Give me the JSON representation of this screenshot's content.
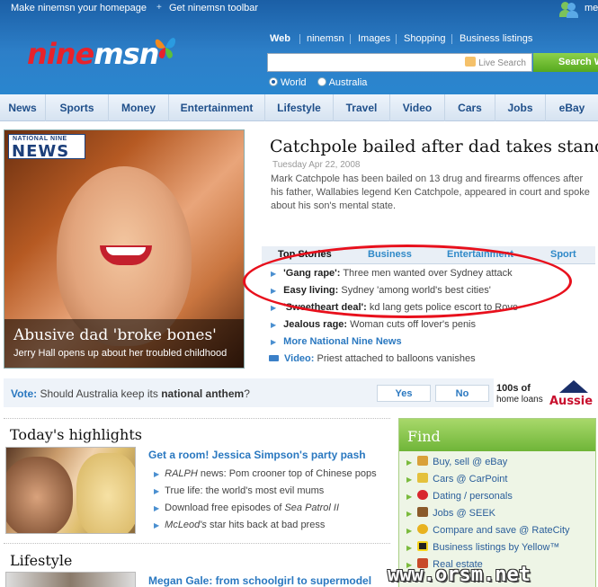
{
  "toplinks": {
    "homepage": "Make ninemsn your homepage",
    "toolbar_icon": "plus-icon",
    "toolbar": "Get ninemsn toolbar",
    "user": "me"
  },
  "logo": {
    "nine": "nine",
    "msn": "msn",
    "icon": "butterfly-icon"
  },
  "search": {
    "tabs": [
      {
        "label": "Web",
        "active": true
      },
      {
        "label": "ninemsn"
      },
      {
        "label": "Images"
      },
      {
        "label": "Shopping"
      },
      {
        "label": "Business listings"
      }
    ],
    "placeholder": "",
    "value": "",
    "live_search_label": "Live Search",
    "button_label": "Search W",
    "scopes": [
      {
        "label": "World",
        "selected": true
      },
      {
        "label": "Australia",
        "selected": false
      }
    ]
  },
  "nav": {
    "items": [
      "News",
      "Sports",
      "Money",
      "Entertainment",
      "Lifestyle",
      "Travel",
      "Video",
      "Cars",
      "Jobs",
      "eBay"
    ]
  },
  "feature": {
    "badge_small": "NATIONAL NINE",
    "badge_big": "NEWS",
    "title": "Abusive dad 'broke bones'",
    "subtitle": "Jerry Hall opens up about her troubled childhood"
  },
  "main_story": {
    "title": "Catchpole bailed after dad takes stand",
    "date": "Tuesday Apr 22, 2008",
    "body": "Mark Catchpole has been bailed on 13 drug and firearms offences after his father, Wallabies legend Ken Catchpole, appeared in court and spoke about his son's mental state."
  },
  "stories": {
    "tabs": [
      {
        "label": "Top Stories",
        "active": true
      },
      {
        "label": "Business"
      },
      {
        "label": "Entertainment"
      },
      {
        "label": "Sport"
      }
    ],
    "items": [
      {
        "lead": "'Gang rape':",
        "text": " Three men wanted over Sydney attack"
      },
      {
        "lead": "Easy living:",
        "text": " Sydney 'among world's best cities'"
      },
      {
        "lead": "'Sweetheart deal':",
        "text": " kd lang gets police escort to Rove"
      },
      {
        "lead": "Jealous rage:",
        "text": " Woman cuts off lover's penis"
      }
    ],
    "more": "More National Nine News",
    "video_lead": "Video:",
    "video_text": " Priest attached to balloons vanishes",
    "highlight_color": "#e8101c"
  },
  "vote": {
    "label": "Vote:",
    "question_pre": " Should Australia keep its ",
    "question_bold": "national anthem",
    "question_post": "?",
    "yes": "Yes",
    "no": "No"
  },
  "ad": {
    "line1": "100s of",
    "line2": "home loans",
    "brand": "Aussie"
  },
  "highlights": {
    "title": "Today's highlights",
    "headline": "Get a room! Jessica Simpson's party pash",
    "items": [
      {
        "em": "RALPH",
        "text": " news: Pom crooner top of Chinese pops"
      },
      {
        "em": "",
        "text": "True life: the world's most evil mums"
      },
      {
        "em_pre": "Download free episodes of ",
        "em": "Sea Patrol II",
        "text": ""
      },
      {
        "em": "McLeod's",
        "text": " star hits back at bad press"
      }
    ]
  },
  "lifestyle": {
    "title": "Lifestyle",
    "headline": "Megan Gale: from schoolgirl to supermodel"
  },
  "find": {
    "title": "Find",
    "items": [
      {
        "label": "Buy, sell @ eBay",
        "icon": "hammer-icon",
        "color": "#d9a13a"
      },
      {
        "label": "Cars @ CarPoint",
        "icon": "car-icon",
        "color": "#e4c13c"
      },
      {
        "label": "Dating / personals",
        "icon": "heart-icon",
        "color": "#d8262e"
      },
      {
        "label": "Jobs @ SEEK",
        "icon": "briefcase-icon",
        "color": "#8a5a2a"
      },
      {
        "label": "Compare and save @ RateCity",
        "icon": "coin-icon",
        "color": "#e8b21f"
      },
      {
        "label": "Business listings by Yellow™",
        "icon": "yellow-book-icon",
        "color": "#222222"
      },
      {
        "label": "Real estate",
        "icon": "house-icon",
        "color": "#c84a2a"
      }
    ]
  },
  "watermark": "www.orsm.net",
  "colors": {
    "header_blue": "#2d7fc8",
    "brand_red": "#e8222b",
    "link_blue": "#2a78c0",
    "find_green": "#6fb538"
  }
}
